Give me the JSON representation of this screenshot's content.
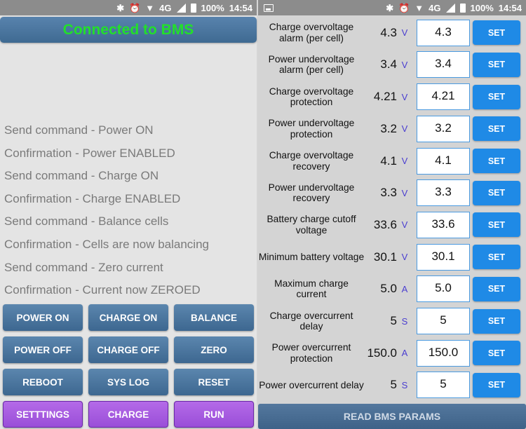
{
  "status_bar": {
    "battery": "100%",
    "time": "14:54",
    "network": "4G",
    "icons": [
      "bluetooth-icon",
      "alarm-icon",
      "wifi-icon",
      "signal-icon",
      "battery-icon"
    ]
  },
  "left": {
    "header": "Connected to BMS",
    "log": [
      "Send command - Power ON",
      "Confirmation - Power ENABLED",
      "Send command - Charge ON",
      "Confirmation - Charge ENABLED",
      "Send command - Balance cells",
      "Confirmation - Cells are now balancing",
      "Send command - Zero current",
      "Confirmation - Current now ZEROED"
    ],
    "buttons": [
      {
        "label": "POWER ON",
        "style": "blue"
      },
      {
        "label": "CHARGE ON",
        "style": "blue"
      },
      {
        "label": "BALANCE",
        "style": "blue"
      },
      {
        "label": "POWER OFF",
        "style": "blue"
      },
      {
        "label": "CHARGE OFF",
        "style": "blue"
      },
      {
        "label": "ZERO",
        "style": "blue"
      },
      {
        "label": "REBOOT",
        "style": "blue"
      },
      {
        "label": "SYS LOG",
        "style": "blue"
      },
      {
        "label": "RESET",
        "style": "blue"
      },
      {
        "label": "SETTTINGS",
        "style": "purple"
      },
      {
        "label": "CHARGE",
        "style": "purple"
      },
      {
        "label": "RUN",
        "style": "purple"
      }
    ]
  },
  "right": {
    "params": [
      {
        "label": "Charge overvoltage alarm (per cell)",
        "value": "4.3",
        "unit": "V",
        "input": "4.3"
      },
      {
        "label": "Power undervoltage alarm (per cell)",
        "value": "3.4",
        "unit": "V",
        "input": "3.4"
      },
      {
        "label": "Charge overvoltage protection",
        "value": "4.21",
        "unit": "V",
        "input": "4.21"
      },
      {
        "label": "Power undervoltage protection",
        "value": "3.2",
        "unit": "V",
        "input": "3.2"
      },
      {
        "label": "Charge overvoltage recovery",
        "value": "4.1",
        "unit": "V",
        "input": "4.1"
      },
      {
        "label": "Power undervoltage recovery",
        "value": "3.3",
        "unit": "V",
        "input": "3.3"
      },
      {
        "label": "Battery charge cutoff voltage",
        "value": "33.6",
        "unit": "V",
        "input": "33.6"
      },
      {
        "label": "Minimum battery voltage",
        "value": "30.1",
        "unit": "V",
        "input": "30.1"
      },
      {
        "label": "Maximum charge current",
        "value": "5.0",
        "unit": "A",
        "input": "5.0"
      },
      {
        "label": "Charge overcurrent delay",
        "value": "5",
        "unit": "S",
        "input": "5"
      },
      {
        "label": "Power overcurrent protection",
        "value": "150.0",
        "unit": "A",
        "input": "150.0"
      },
      {
        "label": "Power overcurrent delay",
        "value": "5",
        "unit": "S",
        "input": "5"
      }
    ],
    "set_label": "SET",
    "read_button": "READ BMS PARAMS"
  }
}
